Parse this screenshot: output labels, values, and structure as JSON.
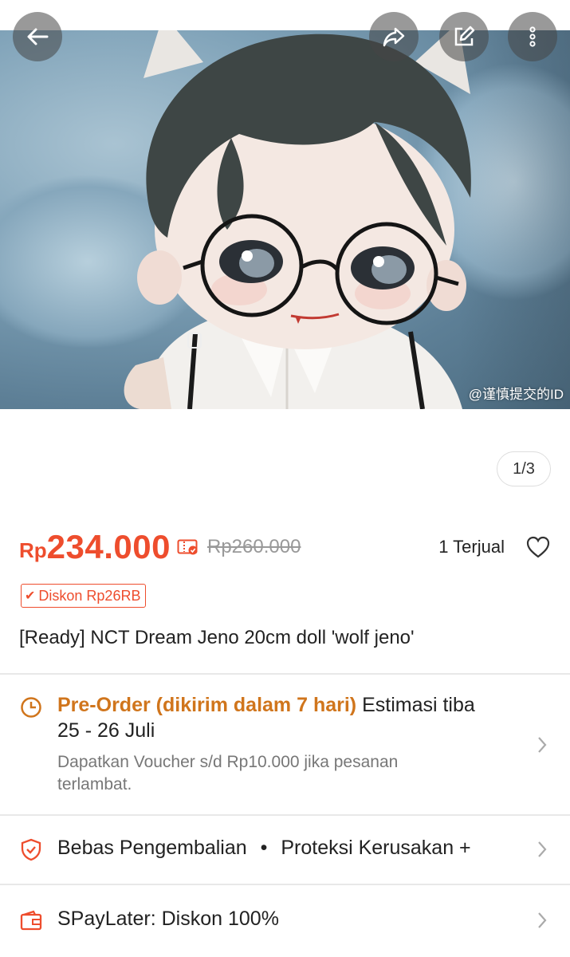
{
  "header": {
    "back_icon": "arrow-left-icon",
    "share_icon": "share-arrow-icon",
    "edit_icon": "edit-square-icon",
    "more_icon": "more-vertical-icon"
  },
  "gallery": {
    "watermark": "@谨慎提交的ID",
    "counter": "1/3"
  },
  "product": {
    "currency": "Rp",
    "price": "234.000",
    "old_price": "Rp260.000",
    "sold": "1 Terjual",
    "discount_badge": "Diskon Rp26RB",
    "title": "[Ready] NCT Dream Jeno 20cm doll 'wolf jeno'"
  },
  "shipping": {
    "preorder_label": "Pre-Order (dikirim dalam 7 hari)",
    "estimasi_label": "Estimasi tiba",
    "date_range": "25 - 26 Juli",
    "voucher_note": "Dapatkan Voucher s/d Rp10.000 jika pesanan terlambat."
  },
  "protection": {
    "text_1": "Bebas Pengembalian",
    "separator": "•",
    "text_2": "Proteksi Kerusakan +"
  },
  "paylater": {
    "text": "SPayLater: Diskon 100%"
  },
  "colors": {
    "brand": "#ee4d2d",
    "preorder": "#d0751c"
  }
}
